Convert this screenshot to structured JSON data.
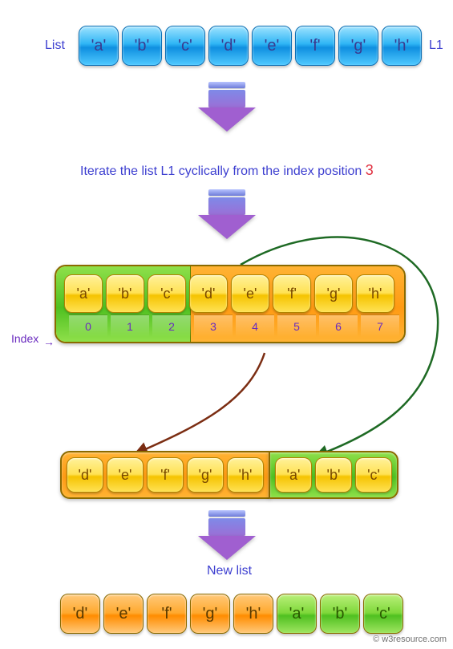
{
  "labels": {
    "list": "List",
    "l1": "L1",
    "index": "Index",
    "new_list": "New list",
    "credit": "© w3resource.com"
  },
  "caption": {
    "part1": "Iterate the list ",
    "l1": "L1",
    "part2": " cyclically from the index position ",
    "index": "3"
  },
  "chart_data": {
    "type": "table",
    "original_list": [
      "'a'",
      "'b'",
      "'c'",
      "'d'",
      "'e'",
      "'f'",
      "'g'",
      "'h'"
    ],
    "indices": [
      0,
      1,
      2,
      3,
      4,
      5,
      6,
      7
    ],
    "split_index": 3,
    "left_part": [
      "'a'",
      "'b'",
      "'c'"
    ],
    "right_part": [
      "'d'",
      "'e'",
      "'f'",
      "'g'",
      "'h'"
    ],
    "result_list": [
      "'d'",
      "'e'",
      "'f'",
      "'g'",
      "'h'",
      "'a'",
      "'b'",
      "'c'"
    ]
  },
  "colors": {
    "top_cell": "#2fb5f5",
    "left_segment": "#4fc020",
    "right_segment": "#ff9a12",
    "value_cell": "#ffe254",
    "arrow_green": "#1e6a24",
    "arrow_brown": "#7b2d12",
    "text_accent": "#3d3fd0",
    "highlight": "#e03040"
  }
}
